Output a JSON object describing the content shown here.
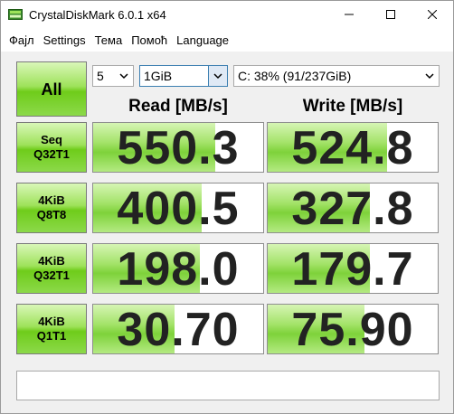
{
  "window": {
    "title": "CrystalDiskMark 6.0.1 x64"
  },
  "menu": {
    "items": [
      {
        "key": "file",
        "label": "Фајл"
      },
      {
        "key": "settings",
        "label": "Settings"
      },
      {
        "key": "theme",
        "label": "Тема"
      },
      {
        "key": "help",
        "label": "Помоћ"
      },
      {
        "key": "language",
        "label": "Language"
      }
    ]
  },
  "controls": {
    "all_label": "All",
    "count_value": "5",
    "size_value": "1GiB",
    "drive_value": "C: 38% (91/237GiB)"
  },
  "headers": {
    "read": "Read [MB/s]",
    "write": "Write [MB/s]"
  },
  "tests": [
    {
      "line1": "Seq",
      "line2": "Q32T1",
      "read": "550.3",
      "write": "524.8",
      "read_fill": 0.72,
      "write_fill": 0.7
    },
    {
      "line1": "4KiB",
      "line2": "Q8T8",
      "read": "400.5",
      "write": "327.8",
      "read_fill": 0.64,
      "write_fill": 0.6
    },
    {
      "line1": "4KiB",
      "line2": "Q32T1",
      "read": "198.0",
      "write": "179.7",
      "read_fill": 0.63,
      "write_fill": 0.6
    },
    {
      "line1": "4KiB",
      "line2": "Q1T1",
      "read": "30.70",
      "write": "75.90",
      "read_fill": 0.48,
      "write_fill": 0.57
    }
  ],
  "status": {
    "text": ""
  },
  "colors": {
    "accent_green": "#6fcc1a",
    "bar_green": "#a4e36a",
    "focus_blue": "#3c7fb1"
  }
}
